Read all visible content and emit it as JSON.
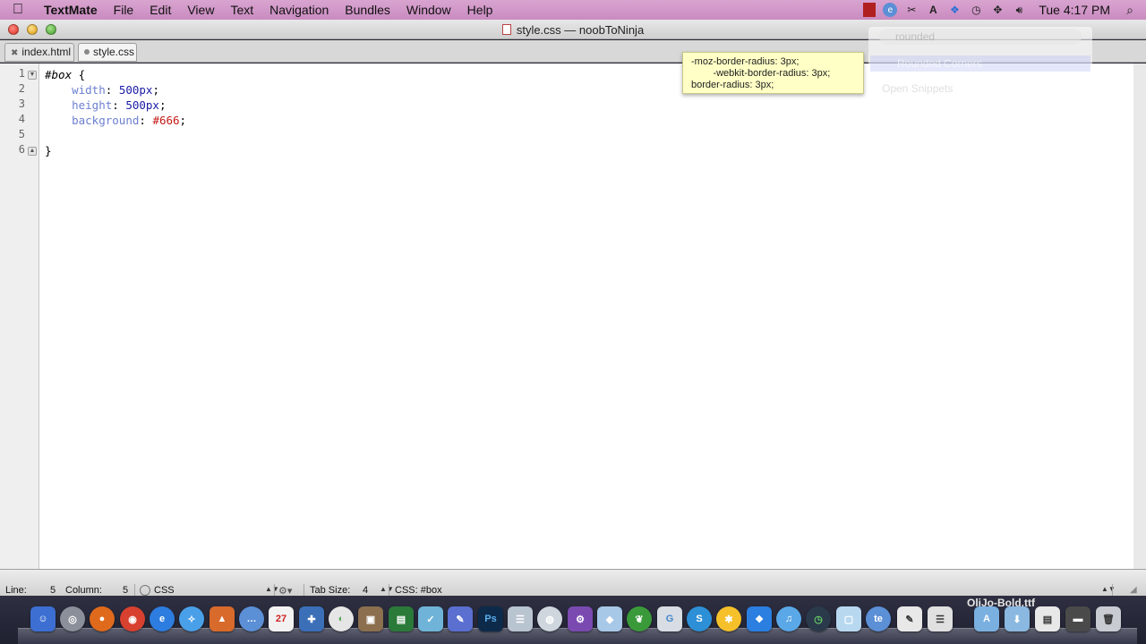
{
  "menubar": {
    "app": "TextMate",
    "items": [
      "File",
      "Edit",
      "View",
      "Text",
      "Navigation",
      "Bundles",
      "Window",
      "Help"
    ],
    "clock": "Tue 4:17 PM"
  },
  "window": {
    "title": "style.css — noobToNinja"
  },
  "tabs": [
    {
      "label": "index.html"
    },
    {
      "label": "style.css"
    }
  ],
  "editor": {
    "line_numbers": [
      "1",
      "2",
      "3",
      "4",
      "5",
      "6"
    ],
    "lines": [
      {
        "selector": "#box",
        "brace": " {"
      },
      {
        "indent": "    ",
        "property": "width",
        "colon": ": ",
        "value": "500px",
        "end": ";"
      },
      {
        "indent": "    ",
        "property": "height",
        "colon": ": ",
        "value": "500px",
        "end": ";"
      },
      {
        "indent": "    ",
        "property": "background",
        "colon": ": ",
        "value": "#666",
        "end": ";"
      },
      {
        "text": ""
      },
      {
        "text": "}"
      }
    ]
  },
  "tooltip": {
    "text": "-moz-border-radius: 3px;\n        -webkit-border-radius: 3px;\nborder-radius: 3px;"
  },
  "snippet_popup": {
    "search": "rounded",
    "selected": "Rounded Corners",
    "footer": "Open Snippets"
  },
  "statusbar": {
    "line_label": "Line:",
    "line_value": "5",
    "column_label": "Column:",
    "column_value": "5",
    "language": "CSS",
    "tab_size_label": "Tab Size:",
    "tab_size_value": "4",
    "symbol": "CSS: #box"
  },
  "dock": {
    "hover_label": "OliJo-Bold.ttf"
  }
}
